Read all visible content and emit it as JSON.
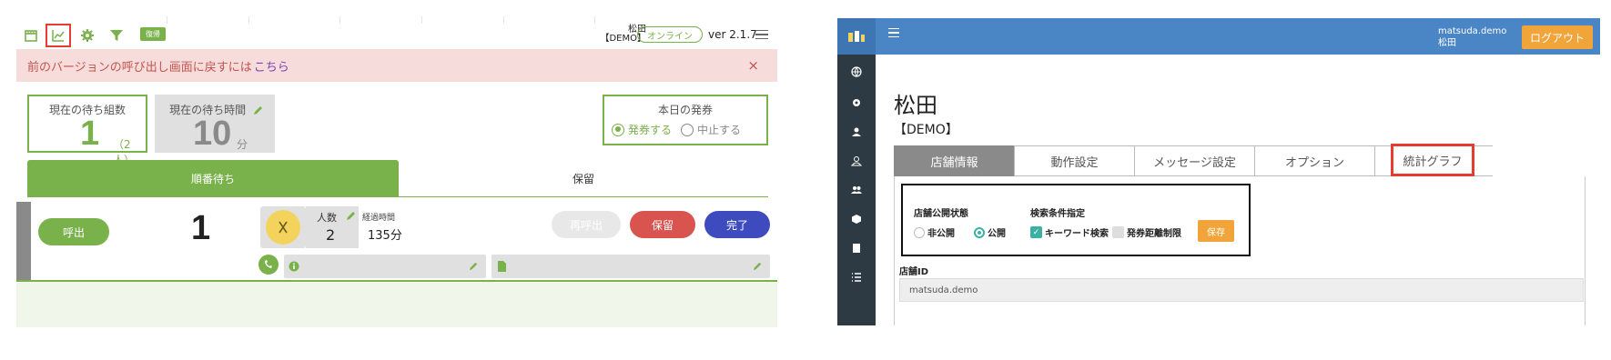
{
  "left": {
    "toolbar": {
      "icons": [
        "shop-icon",
        "chart-icon",
        "gear-icon",
        "filter-icon"
      ],
      "rest_badge": "復帰",
      "user_name": "松田",
      "user_store": "【DEMO】",
      "status": "オンライン",
      "version": "ver 2.1.7"
    },
    "alert": {
      "text": "前のバージョンの呼び出し画面に戻すには",
      "link": "こちら",
      "close": "×"
    },
    "wait_groups": {
      "label": "現在の待ち組数",
      "value": "1",
      "sub": "（2人）"
    },
    "wait_time": {
      "label": "現在の待ち時間",
      "value": "10",
      "unit": "分"
    },
    "issue": {
      "label": "本日の発券",
      "options": [
        "発券する",
        "中止する"
      ],
      "selected": "発券する"
    },
    "tabs": [
      "順番待ち",
      "保留"
    ],
    "queue": [
      {
        "call_label": "呼出",
        "number": "1",
        "people_label": "人数",
        "people": "2",
        "elapsed_label": "経過時間",
        "elapsed": "135分",
        "recall_label": "再呼出",
        "hold_label": "保留",
        "done_label": "完了"
      }
    ],
    "colors": {
      "accent": "#79b14b",
      "alert_bg": "#f6dcdb",
      "hold": "#d9534f",
      "done": "#3e4bbf"
    }
  },
  "right": {
    "header": {
      "account": "matsuda.demo",
      "name": "松田",
      "logout": "ログアウト"
    },
    "sidebar_icons": [
      "globe-icon",
      "gear-icon",
      "user-icon",
      "user-outline-icon",
      "users-icon",
      "box-icon",
      "book-icon",
      "list-icon"
    ],
    "title": "松田",
    "store": "【DEMO】",
    "tabs": [
      "店舗情報",
      "動作設定",
      "メッセージ設定",
      "オプション",
      "統計グラフ"
    ],
    "active_tab": "店舗情報",
    "highlighted_tab": "統計グラフ",
    "settings": {
      "status_label": "店舗公開状態",
      "status_options": [
        "非公開",
        "公開"
      ],
      "status_selected": "公開",
      "search_label": "検索条件指定",
      "search_options": [
        "キーワード検索",
        "発券距離制限"
      ],
      "search_checked": [
        "キーワード検索"
      ],
      "save": "保存"
    },
    "store_id_label": "店舗ID",
    "store_id": "matsuda.demo",
    "colors": {
      "header": "#4a86c5",
      "sidebar": "#2d3a44",
      "logout": "#f0a43a",
      "highlight": "#e53d2f"
    }
  }
}
